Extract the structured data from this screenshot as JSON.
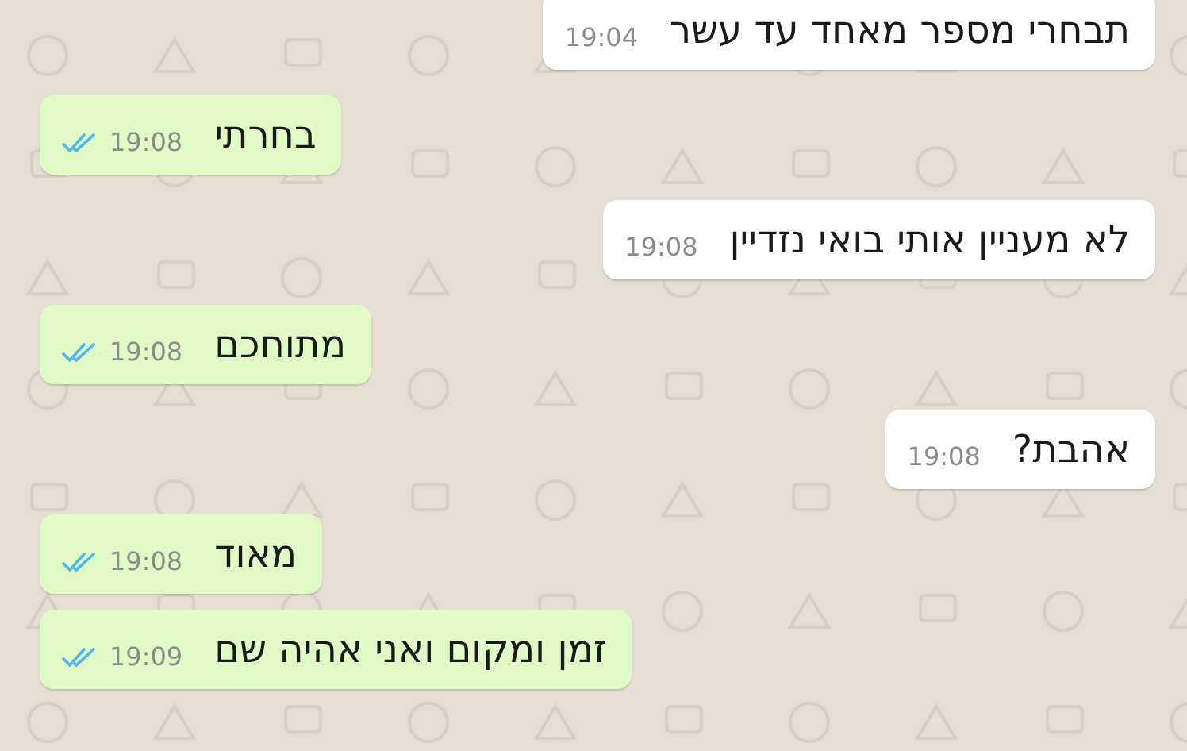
{
  "messages": [
    {
      "kind": "incoming",
      "text": "תבחרי מספר מאחד עד עשר",
      "time": "19:04"
    },
    {
      "kind": "outgoing",
      "text": "בחרתי",
      "time": "19:08",
      "read": true
    },
    {
      "kind": "incoming",
      "text": "לא מעניין אותי בואי נזדיין",
      "time": "19:08"
    },
    {
      "kind": "outgoing",
      "text": "מתוחכם",
      "time": "19:08",
      "read": true
    },
    {
      "kind": "incoming",
      "text": "אהבת?",
      "time": "19:08"
    },
    {
      "kind": "outgoing",
      "text": "מאוד",
      "time": "19:08",
      "read": true
    },
    {
      "kind": "outgoing",
      "text": "זמן ומקום ואני אהיה שם",
      "time": "19:09",
      "read": true
    }
  ]
}
